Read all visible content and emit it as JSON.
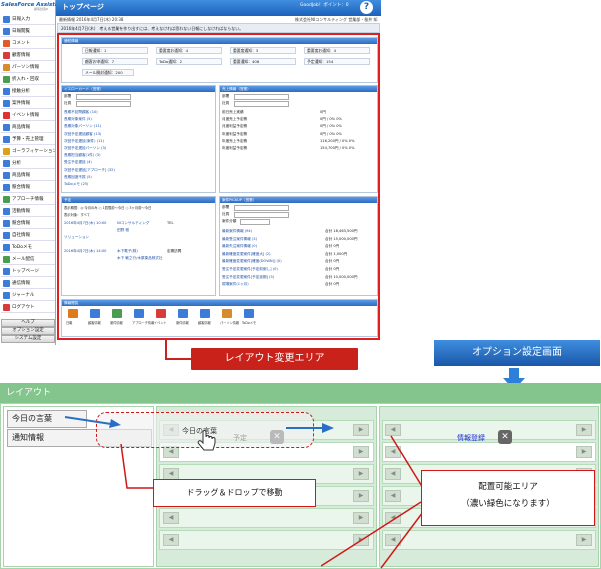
{
  "app": {
    "logo": "SalesForce Assistant",
    "logo_sub": "顧客創造R",
    "page_title": "トップページ",
    "user_info": "GoodJob！ポイント：",
    "points": "0",
    "info_date": "最新情報 2016年4月7日(木) 20:38",
    "info_company": "株式会社NIコンサルティング 営業部・桜井 知"
  },
  "sidebar": {
    "items": [
      {
        "label": "日報入力",
        "color": "#3c7bd8"
      },
      {
        "label": "日報閲覧",
        "color": "#3c7bd8"
      },
      {
        "label": "コメント",
        "color": "#e05a2a"
      },
      {
        "label": "顧客情報",
        "color": "#d93a3a"
      },
      {
        "label": "パーソン情報",
        "color": "#d98a2a"
      },
      {
        "label": "折入れ・回収",
        "color": "#4a9d50"
      },
      {
        "label": "接触分析",
        "color": "#3c7bd8"
      },
      {
        "label": "案件情報",
        "color": "#3c7bd8"
      },
      {
        "label": "イベント情報",
        "color": "#e03030"
      },
      {
        "label": "商品情報",
        "color": "#3c7bd8"
      },
      {
        "label": "予算・売上管理",
        "color": "#3c7bd8"
      },
      {
        "label": "ゴーラフィケーション",
        "color": "#d9a21a"
      },
      {
        "label": "分析",
        "color": "#3c7bd8"
      },
      {
        "label": "商品情報",
        "color": "#3c7bd8"
      },
      {
        "label": "競合情報",
        "color": "#3c7bd8"
      },
      {
        "label": "アプローチ情報",
        "color": "#4a9d50"
      },
      {
        "label": "活動情報",
        "color": "#3c7bd8"
      },
      {
        "label": "競合情報",
        "color": "#3c7bd8"
      },
      {
        "label": "自社情報",
        "color": "#3c7bd8"
      },
      {
        "label": "ToDoメモ",
        "color": "#3c7bd8"
      },
      {
        "label": "メール配信",
        "color": "#4a9d50"
      },
      {
        "label": "トップページ",
        "color": "#3c7bd8"
      },
      {
        "label": "通信情報",
        "color": "#3c7bd8"
      },
      {
        "label": "ジャーナル",
        "color": "#3c7bd8"
      },
      {
        "label": "ログアウト",
        "color": "#d93a3a"
      }
    ],
    "btn_help": "ヘルプ",
    "btn_option": "オプション設定",
    "btn_system": "システム設定"
  },
  "banner": "2016年4月7日(木)　考える営業を作り出すには、考えなければ思わない日報にしなければならない。",
  "notice": {
    "title": "通知情報",
    "cells": [
      [
        "日報通知：1",
        "重要度お通知：4",
        "重要度通知：3",
        "重要度お通知：4"
      ],
      [
        "顧客お申通知：7",
        "ToDo通知：2",
        "重要通知：408",
        "予定通知：154"
      ],
      [
        "メール開封通知：200",
        "",
        "",
        ""
      ]
    ]
  },
  "yellow": {
    "title": "イエローカード（営業）",
    "lbl_dept": "部署",
    "lbl_staff": "社員",
    "rows": [
      "長期不訪問顧客 (10)",
      "長期対象案件 (5)",
      "長期対象パーソン (11)",
      "次回予定遅延顧客 (13)",
      "次回予定遅延(案件) (11)",
      "次回予定遅延パーソン (3)",
      "長期担当顧客(1件) (3)",
      "受注予定遅延 (4)",
      "次回予定遅延[アプローチ] (32)",
      "長期回遊不振 (5)",
      "ToDoメモ (25)"
    ]
  },
  "sales": {
    "title": "売上情報（営業）",
    "lbl_dept": "部署",
    "lbl_staff": "社員",
    "rows": [
      [
        "前日売上実績",
        "0円"
      ],
      [
        "月度売上予定積",
        "0円 / 0% 0%"
      ],
      [
        "月度利益予定積",
        "0円 / 0% 0%"
      ],
      [
        "年度利益予定積",
        "0円 / 0% 0%"
      ],
      [
        "年度売上予定積",
        "116,200円 / 0% 0%"
      ],
      [
        "年度利益予定積",
        "154,700円 / 0% 0%"
      ]
    ]
  },
  "schedule": {
    "title": "予定",
    "line1": "表示期間：◎ 今月のみ ○ 1週間前〜今日 ○ 3ヶ月前〜今日",
    "line2": "表示対象：すべて",
    "items": [
      {
        "date": "2016年4月7日(木) 10:00",
        "co": "NIコンサルティング",
        "tel": "TEL",
        "person": "田野 雅"
      },
      {
        "date": "ソリューション",
        "co": "",
        "tel": "",
        "person": ""
      },
      {
        "date": "2016年4月7日(木) 14:00",
        "co": "木下電子(株)",
        "tel": "定期訪問",
        "person": "木下 敏之行/木原薬品株式社"
      }
    ]
  },
  "deals": {
    "title": "案件PICKUP（営業）",
    "lbl_dept": "部署",
    "lbl_staff": "社員",
    "lbl_cat": "案件分類",
    "rows": [
      [
        "最新案件情報 (94)",
        "合計 18,463,500円"
      ],
      [
        "最新受注案件情報 (3)",
        "合計 15,000,000円"
      ],
      [
        "最新失注案件情報 (0)",
        "合計 0円"
      ],
      [
        "最新確度変更案件[確度大] (2)",
        "合計 1,000円"
      ],
      [
        "最新確度変更案件[確度(DOWN)] (0)",
        "合計 0円"
      ],
      [
        "受注予定変更案件[予定前倒し] (0)",
        "合計 0円"
      ],
      [
        "受注予定変更案件[予定延期] (5)",
        "合計 10,000,000円"
      ],
      [
        "現場案件(1ヶ月)",
        "合計 0円"
      ]
    ]
  },
  "links": {
    "title": "情報閲覧",
    "items": [
      "日報",
      "顧客情報",
      "案件情報",
      "アプローチ情報",
      "イベント",
      "案件情報",
      "顧客情報",
      "パーソン情報",
      "ToDoメモ"
    ]
  },
  "callouts": {
    "layout_change": "レイアウト変更エリア",
    "option_screen": "オプション設定画面",
    "drag_drop": "ドラッグ＆ドロップで移動",
    "area_line1": "配置可能エリア",
    "area_line2": "（濃い緑色になります）"
  },
  "layout_window": {
    "title": "レイアウト",
    "left_list": [
      "今日の言葉",
      "通知情報"
    ],
    "dragged": "今日の言葉",
    "cell_schedule": "予定",
    "cell_info": "情報登録"
  }
}
